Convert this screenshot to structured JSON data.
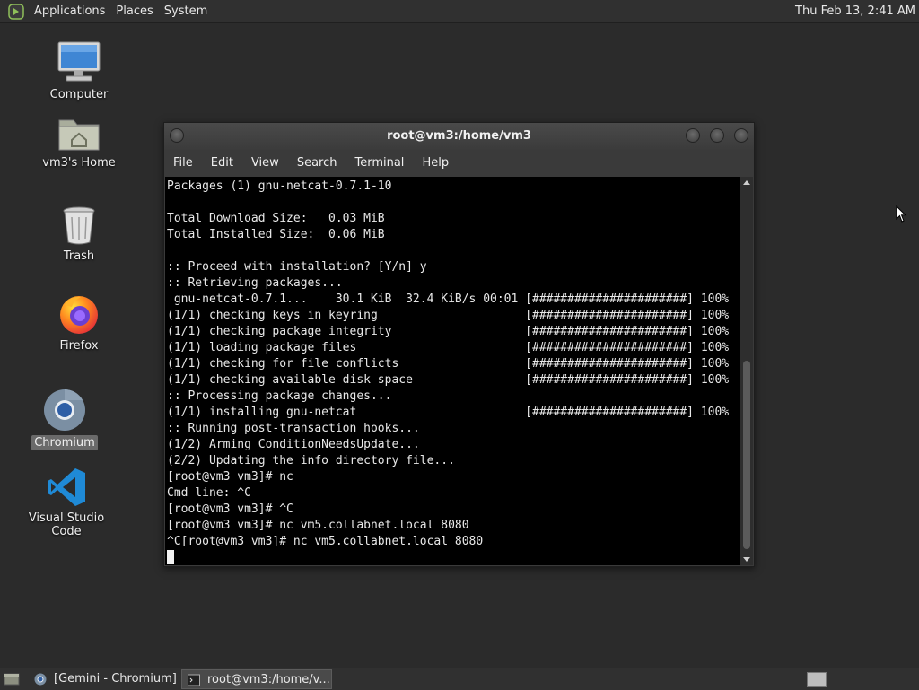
{
  "top_panel": {
    "menus": [
      "Applications",
      "Places",
      "System"
    ],
    "clock": "Thu Feb 13,  2:41 AM"
  },
  "desktop_icons": [
    {
      "label": "Computer",
      "icon": "computer-icon"
    },
    {
      "label": "vm3's Home",
      "icon": "home-folder-icon"
    },
    {
      "label": "Trash",
      "icon": "trash-icon"
    },
    {
      "label": "Firefox",
      "icon": "firefox-icon"
    },
    {
      "label": "Chromium",
      "icon": "chromium-icon",
      "selected": true
    },
    {
      "label": "Visual Studio Code",
      "icon": "vscode-icon"
    }
  ],
  "terminal": {
    "title": "root@vm3:/home/vm3",
    "menus": [
      "File",
      "Edit",
      "View",
      "Search",
      "Terminal",
      "Help"
    ],
    "lines": [
      "Packages (1) gnu-netcat-0.7.1-10",
      "",
      "Total Download Size:   0.03 MiB",
      "Total Installed Size:  0.06 MiB",
      "",
      ":: Proceed with installation? [Y/n] y",
      ":: Retrieving packages...",
      " gnu-netcat-0.7.1...    30.1 KiB  32.4 KiB/s 00:01 [######################] 100%",
      "(1/1) checking keys in keyring                     [######################] 100%",
      "(1/1) checking package integrity                   [######################] 100%",
      "(1/1) loading package files                        [######################] 100%",
      "(1/1) checking for file conflicts                  [######################] 100%",
      "(1/1) checking available disk space                [######################] 100%",
      ":: Processing package changes...",
      "(1/1) installing gnu-netcat                        [######################] 100%",
      ":: Running post-transaction hooks...",
      "(1/2) Arming ConditionNeedsUpdate...",
      "(2/2) Updating the info directory file...",
      "[root@vm3 vm3]# nc",
      "Cmd line: ^C",
      "[root@vm3 vm3]# ^C",
      "[root@vm3 vm3]# nc vm5.collabnet.local 8080",
      "^C[root@vm3 vm3]# nc vm5.collabnet.local 8080"
    ]
  },
  "taskbar": {
    "tasks": [
      {
        "label": "[Gemini - Chromium]",
        "icon": "chromium-icon"
      },
      {
        "label": "root@vm3:/home/v...",
        "icon": "terminal-icon",
        "active": true
      }
    ]
  },
  "colors": {
    "desktop_bg": "#2b2b2b",
    "panel_bg": "#303030",
    "terminal_bg": "#000000",
    "terminal_fg": "#e8e8e8"
  }
}
